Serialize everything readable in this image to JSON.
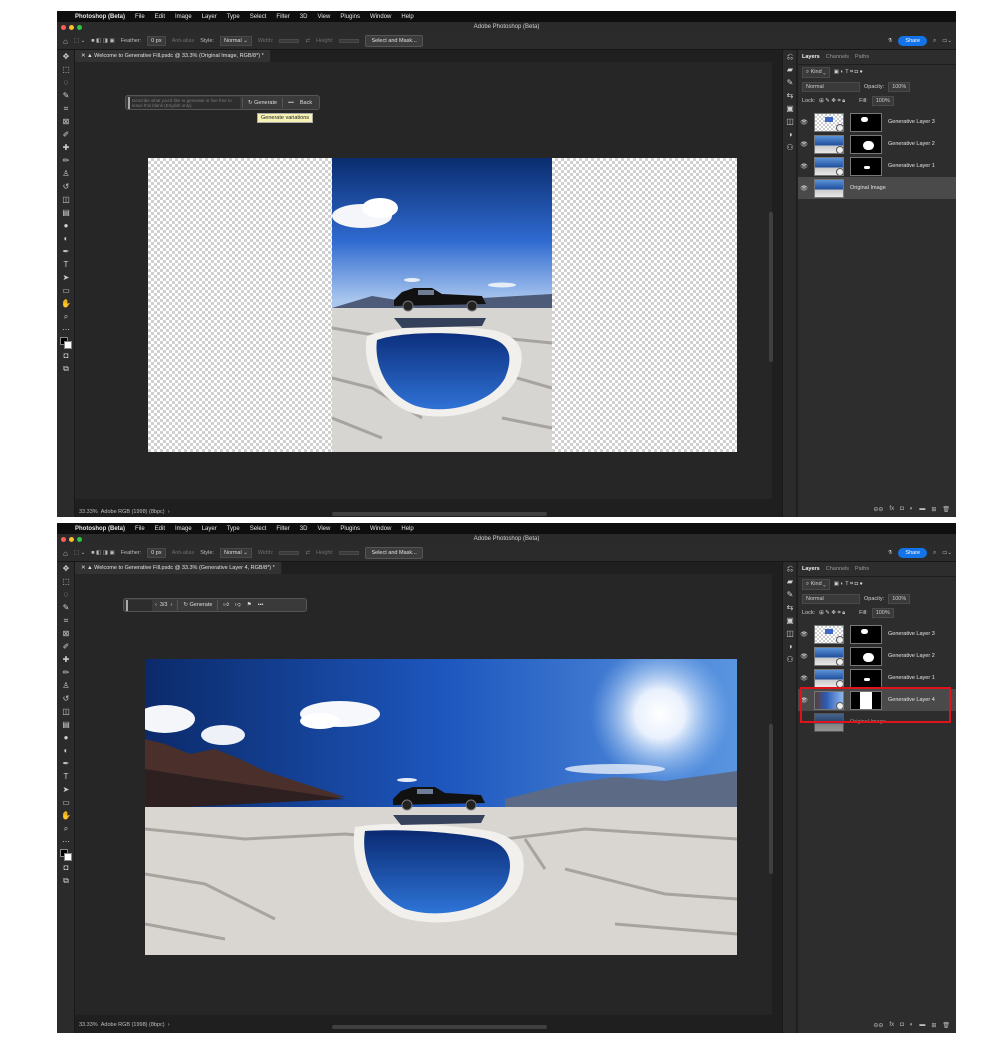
{
  "menu": {
    "app_name": "Photoshop (Beta)",
    "items": [
      "File",
      "Edit",
      "Image",
      "Layer",
      "Type",
      "Select",
      "Filter",
      "3D",
      "View",
      "Plugins",
      "Window",
      "Help"
    ]
  },
  "window_title": "Adobe Photoshop (Beta)",
  "options_bar": {
    "feather_label": "Feather:",
    "feather_value": "0 px",
    "antialias_label": "Anti-alias",
    "style_label": "Style:",
    "style_value": "Normal",
    "width_label": "Width:",
    "height_label": "Height:",
    "select_mask_label": "Select and Mask...",
    "share_label": "Share"
  },
  "shot1": {
    "doc_tab": "Welcome to Generative Fill.psdc @ 33.3% (Original Image, RGB/8*) *",
    "prompt_placeholder": "Describe what you'd like to generate or live free to leave this blank (English only).",
    "generate_label": "Generate",
    "more_label": "•••",
    "back_label": "Back",
    "tooltip": "Generate variations",
    "status_zoom": "33.33%",
    "status_profile": "Adobe RGB (1998) (8bpc)",
    "layers": [
      {
        "name": "Generative Layer 3"
      },
      {
        "name": "Generative Layer 2"
      },
      {
        "name": "Generative Layer 1"
      },
      {
        "name": "Original Image"
      }
    ]
  },
  "shot2": {
    "doc_tab": "Welcome to Generative Fill.psdc @ 33.3% (Generative Layer 4, RGB/8*) *",
    "variation_counter": "3/3",
    "generate_label": "Generate",
    "more_label": "•••",
    "status_zoom": "33.33%",
    "status_profile": "Adobe RGB (1998) (8bpc)",
    "layers": [
      {
        "name": "Generative Layer 3"
      },
      {
        "name": "Generative Layer 2"
      },
      {
        "name": "Generative Layer 1"
      },
      {
        "name": "Generative Layer 4"
      },
      {
        "name": "Original Image"
      }
    ]
  },
  "layers_panel": {
    "tabs": [
      "Layers",
      "Channels",
      "Paths"
    ],
    "kind_label": "Kind",
    "blend_mode": "Normal",
    "opacity_label": "Opacity:",
    "opacity_value": "100%",
    "lock_label": "Lock:",
    "fill_label": "Fill:",
    "fill_value": "100%"
  },
  "colors": {
    "highlight_box": "#e0121b",
    "share_button": "#1473e6",
    "tooltip_bg": "#f7f3b5"
  }
}
